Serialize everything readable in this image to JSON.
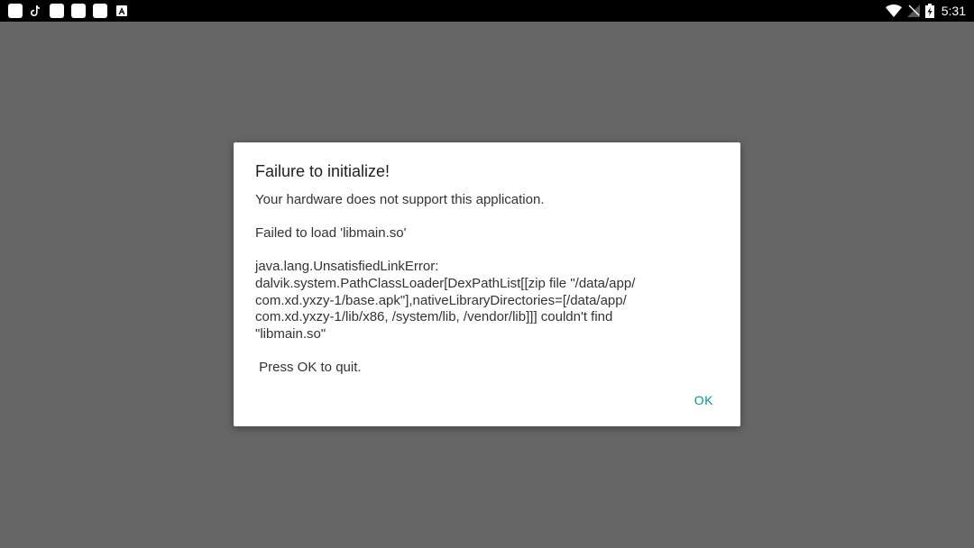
{
  "status_bar": {
    "time": "5:31",
    "left_icons": [
      "app-notification-icon",
      "tiktok-icon",
      "app-notification-icon",
      "app-notification-icon",
      "app-notification-icon",
      "a-box-icon"
    ],
    "right_icons": [
      "wifi-icon",
      "no-sim-icon",
      "battery-charging-icon"
    ]
  },
  "dialog": {
    "title": "Failure to initialize!",
    "line1": "Your hardware does not support this application.",
    "line2": "Failed to load 'libmain.so'",
    "error_l1": "java.lang.UnsatisfiedLinkError:",
    "error_l2": "dalvik.system.PathClassLoader[DexPathList[[zip file \"/data/app/",
    "error_l3": "com.xd.yxzy-1/base.apk\"],nativeLibraryDirectories=[/data/app/",
    "error_l4": "com.xd.yxzy-1/lib/x86, /system/lib, /vendor/lib]]] couldn't find",
    "error_l5": "\"libmain.so\"",
    "line3": " Press OK to quit.",
    "ok_label": "OK"
  },
  "colors": {
    "scrim": "#666666",
    "status_bar": "#000000",
    "accent": "#00968a"
  }
}
